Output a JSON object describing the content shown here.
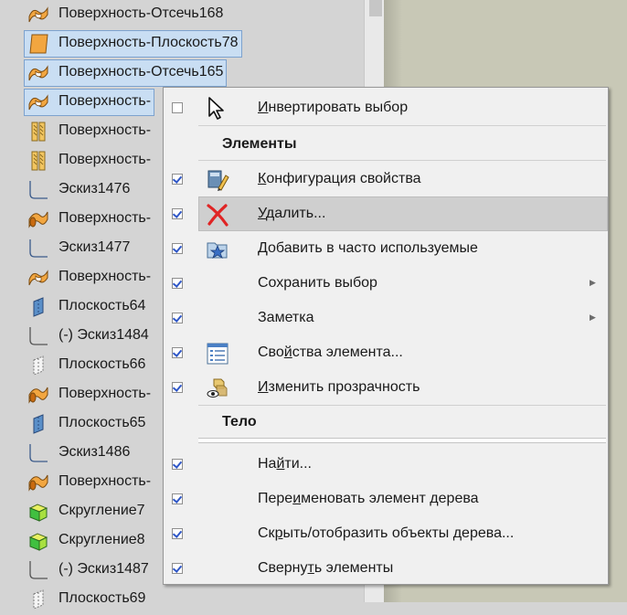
{
  "tree": {
    "items": [
      {
        "label": "Поверхность-Отсечь168",
        "icon": "surface-trim-icon",
        "selected": false
      },
      {
        "label": "Поверхность-Плоскость78",
        "icon": "planar-surface-icon",
        "selected": true
      },
      {
        "label": "Поверхность-Отсечь165",
        "icon": "surface-trim-icon",
        "selected": true
      },
      {
        "label": "Поверхность-",
        "icon": "surface-trim-icon",
        "selected": true
      },
      {
        "label": "Поверхность-",
        "icon": "surface-knit-icon",
        "selected": false
      },
      {
        "label": "Поверхность-",
        "icon": "surface-knit-icon",
        "selected": false
      },
      {
        "label": "Эскиз1476",
        "icon": "sketch-icon",
        "selected": false
      },
      {
        "label": "Поверхность-",
        "icon": "surface-sweep-icon",
        "selected": false
      },
      {
        "label": "Эскиз1477",
        "icon": "sketch-icon",
        "selected": false
      },
      {
        "label": "Поверхность-",
        "icon": "surface-trim-icon",
        "selected": false
      },
      {
        "label": "Плоскость64",
        "icon": "plane-icon",
        "selected": false
      },
      {
        "label": "(-) Эскиз1484",
        "icon": "sketch-underdefined-icon",
        "selected": false
      },
      {
        "label": "Плоскость66",
        "icon": "plane-hidden-icon",
        "selected": false
      },
      {
        "label": "Поверхность-",
        "icon": "surface-sweep-icon",
        "selected": false
      },
      {
        "label": "Плоскость65",
        "icon": "plane-icon",
        "selected": false
      },
      {
        "label": "Эскиз1486",
        "icon": "sketch-icon",
        "selected": false
      },
      {
        "label": "Поверхность-",
        "icon": "surface-sweep-icon",
        "selected": false
      },
      {
        "label": "Скругление7",
        "icon": "fillet-icon",
        "selected": false
      },
      {
        "label": "Скругление8",
        "icon": "fillet-icon",
        "selected": false
      },
      {
        "label": "(-) Эскиз1487",
        "icon": "sketch-underdefined-icon",
        "selected": false
      },
      {
        "label": "Плоскость69",
        "icon": "plane-hidden-icon",
        "selected": false
      }
    ]
  },
  "menu": {
    "invert": {
      "pre": "",
      "ul": "И",
      "post": "нвертировать выбор"
    },
    "section_elements": "Элементы",
    "config": {
      "pre": "",
      "ul": "К",
      "post": "онфигурация свойства"
    },
    "delete": {
      "pre": "",
      "ul": "У",
      "post": "далить..."
    },
    "favorites": {
      "pre": "",
      "ul": "Д",
      "post": "обавить в часто используемые"
    },
    "save_selection": "Сохранить выбор",
    "note": "Заметка",
    "props": {
      "pre": "Сво",
      "ul": "й",
      "post": "ства элемента..."
    },
    "transparency": {
      "pre": "",
      "ul": "И",
      "post": "зменить прозрачность"
    },
    "section_body": "Тело",
    "find": {
      "pre": "На",
      "ul": "й",
      "post": "ти..."
    },
    "rename": {
      "pre": "Пере",
      "ul": "и",
      "post": "меновать элемент дерева"
    },
    "hide_show": {
      "pre": "Ск",
      "ul": "р",
      "post": "ыть/отобразить объекты дерева..."
    },
    "collapse": {
      "pre": "Сверну",
      "ul": "т",
      "post": "ь элементы"
    }
  }
}
